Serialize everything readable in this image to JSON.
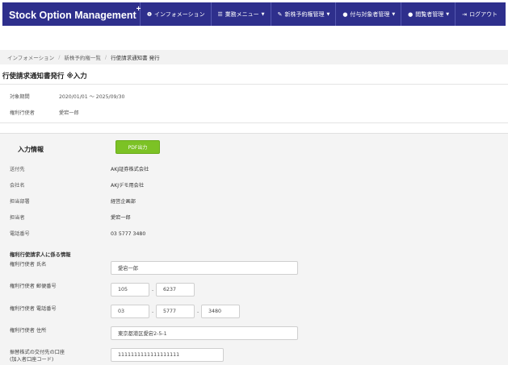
{
  "navbar": {
    "brand": "Stock Option Management",
    "brand_sup": "+",
    "items": [
      {
        "icon": "info-icon",
        "glyph": "❶",
        "label": "インフォメーション",
        "caret": false
      },
      {
        "icon": "menu-list-icon",
        "glyph": "☰",
        "label": "業務メニュー",
        "caret": true
      },
      {
        "icon": "tag-icon",
        "glyph": "✎",
        "label": "新株予約権管理",
        "caret": true
      },
      {
        "icon": "user-icon",
        "glyph": "●",
        "label": "付与対象者管理",
        "caret": true
      },
      {
        "icon": "admin-user-icon",
        "glyph": "●",
        "label": "閲覧者管理",
        "caret": true
      },
      {
        "icon": "logout-icon",
        "glyph": "⇥",
        "label": "ログアウト",
        "caret": false
      }
    ]
  },
  "breadcrumb": {
    "items": [
      "インフォメーション",
      "新株予約権一覧",
      "行使請求通知書 発行"
    ]
  },
  "page_title": "行使請求通知書発行 ※入力",
  "summary": {
    "period_label": "対象期間",
    "period_value": "2020/01/01 〜 2025/09/30",
    "holder_label": "権利行使者",
    "holder_value": "愛宕一郎"
  },
  "input_info": {
    "title": "入力情報",
    "pdf_button": "PDF出力",
    "rows": [
      {
        "label": "送付先",
        "value": "AKJ証券株式会社"
      },
      {
        "label": "会社名",
        "value": "AKJデモ用会社"
      },
      {
        "label": "担当部署",
        "value": "経営企画部"
      },
      {
        "label": "担当者",
        "value": "愛宕一郎"
      },
      {
        "label": "電話番号",
        "value": "03 5777 3480"
      }
    ]
  },
  "requester": {
    "title": "権利行使請求人に係る情報",
    "name_label": "権利行使者 氏名",
    "name_value": "愛宕一郎",
    "zip_label": "権利行使者 郵便番号",
    "zip1": "105",
    "zip2": "6237",
    "phone_label": "権利行使者 電話番号",
    "phone1": "03",
    "phone2": "5777",
    "phone3": "3480",
    "address_label": "権利行使者 住所",
    "address_value": "東京都港区愛宕2-5-1",
    "account_label_1": "振替株式の交付先の口座",
    "account_label_2": "(加入者口座コード)",
    "account_value": "1111111111111111111",
    "dash": "-"
  }
}
